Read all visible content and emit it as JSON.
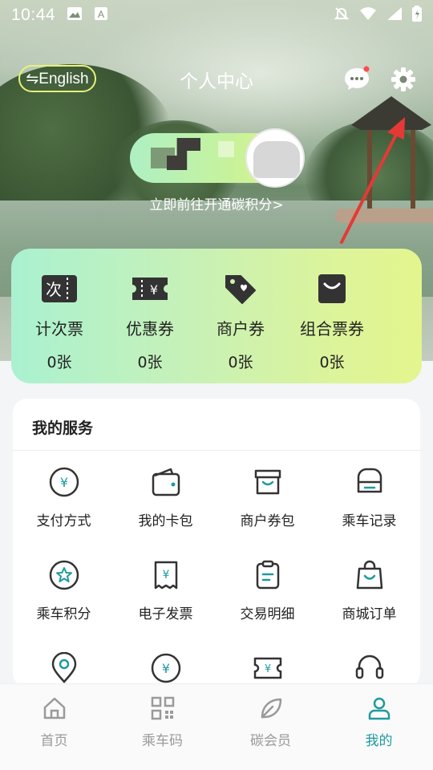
{
  "status_bar": {
    "time": "10:44",
    "icons_left": [
      "image-icon",
      "font-icon"
    ],
    "icons_right": [
      "mute-icon",
      "wifi-icon",
      "signal-icon",
      "battery-icon"
    ]
  },
  "header": {
    "language_toggle": "⇋English",
    "title": "个人中心",
    "message_icon": "chat-bubble-icon",
    "settings_icon": "gear-icon",
    "message_badge_color": "#ff4d4f"
  },
  "carbon": {
    "link_text": "立即前往开通碳积分>"
  },
  "tickets": [
    {
      "icon": "count-ticket-icon",
      "name": "计次票",
      "count": "0张"
    },
    {
      "icon": "coupon-icon",
      "name": "优惠券",
      "count": "0张"
    },
    {
      "icon": "merchant-coupon-icon",
      "name": "商户券",
      "count": "0张"
    },
    {
      "icon": "combo-ticket-icon",
      "name": "组合票券",
      "count": "0张"
    }
  ],
  "services": {
    "title": "我的服务",
    "items": [
      {
        "icon": "yen-circle-icon",
        "label": "支付方式"
      },
      {
        "icon": "wallet-icon",
        "label": "我的卡包"
      },
      {
        "icon": "merchant-box-icon",
        "label": "商户券包"
      },
      {
        "icon": "bus-icon",
        "label": "乘车记录"
      },
      {
        "icon": "star-circle-icon",
        "label": "乘车积分"
      },
      {
        "icon": "invoice-icon",
        "label": "电子发票"
      },
      {
        "icon": "clipboard-icon",
        "label": "交易明细"
      },
      {
        "icon": "shopping-bag-icon",
        "label": "商城订单"
      },
      {
        "icon": "location-icon",
        "label": ""
      },
      {
        "icon": "yen-circle-icon",
        "label": ""
      },
      {
        "icon": "ticket-icon",
        "label": ""
      },
      {
        "icon": "headset-icon",
        "label": ""
      }
    ]
  },
  "tabbar": {
    "items": [
      {
        "icon": "home-icon",
        "label": "首页",
        "active": false
      },
      {
        "icon": "qr-code-icon",
        "label": "乘车码",
        "active": false
      },
      {
        "icon": "leaf-icon",
        "label": "碳会员",
        "active": false
      },
      {
        "icon": "user-icon",
        "label": "我的",
        "active": true
      }
    ],
    "active_color": "#1f9aa0",
    "inactive_color": "#9a9a9a"
  },
  "colors": {
    "accent": "#1f9aa0",
    "annotation_arrow": "#e53935",
    "lang_border": "#e8f27a"
  }
}
